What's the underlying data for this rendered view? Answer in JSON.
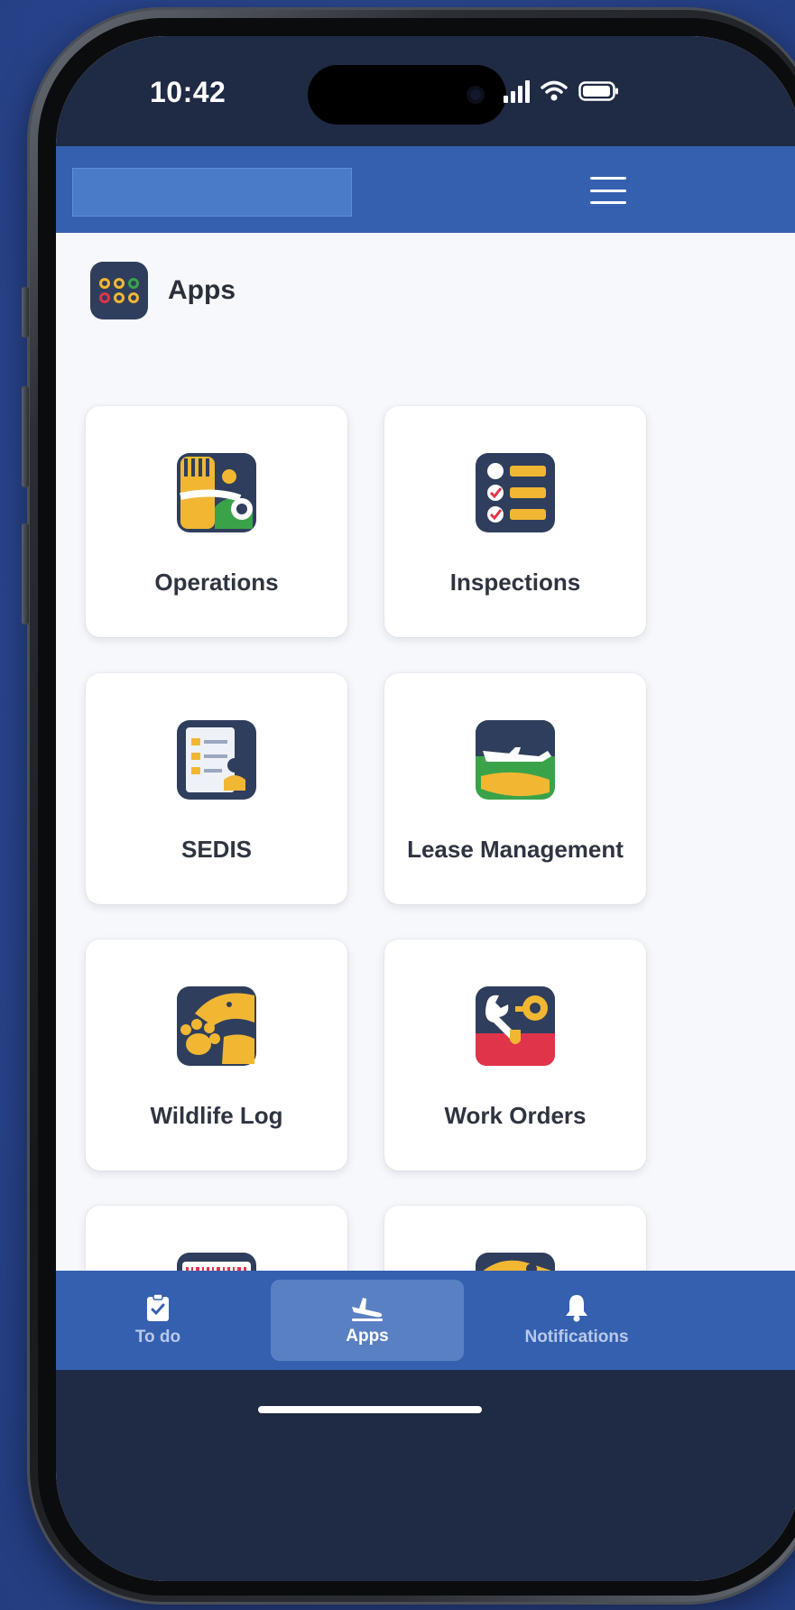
{
  "status_bar": {
    "time": "10:42",
    "icons": [
      "signal-icon",
      "wifi-icon",
      "battery-icon"
    ]
  },
  "header": {
    "menu_icon": "hamburger-menu-icon"
  },
  "section": {
    "title": "Apps",
    "icon": "apps-grid-icon"
  },
  "apps": [
    {
      "label": "Operations",
      "icon": "operations-icon"
    },
    {
      "label": "Inspections",
      "icon": "inspections-checklist-icon"
    },
    {
      "label": "SEDIS",
      "icon": "sedis-document-icon"
    },
    {
      "label": "Lease Management",
      "icon": "lease-airplane-icon"
    },
    {
      "label": "Wildlife Log",
      "icon": "wildlife-bird-paw-icon"
    },
    {
      "label": "Work Orders",
      "icon": "work-orders-wrench-icon"
    }
  ],
  "bottom_nav": {
    "items": [
      {
        "label": "To do",
        "icon": "clipboard-check-icon",
        "active": false
      },
      {
        "label": "Apps",
        "icon": "airplane-takeoff-icon",
        "active": true
      },
      {
        "label": "Notifications",
        "icon": "bell-icon",
        "active": false
      }
    ]
  },
  "colors": {
    "brand_blue": "#3560b0",
    "dark_navy": "#1f2a44",
    "accent_yellow": "#f1b733",
    "accent_red": "#e0344a",
    "accent_green": "#3aa34a"
  }
}
